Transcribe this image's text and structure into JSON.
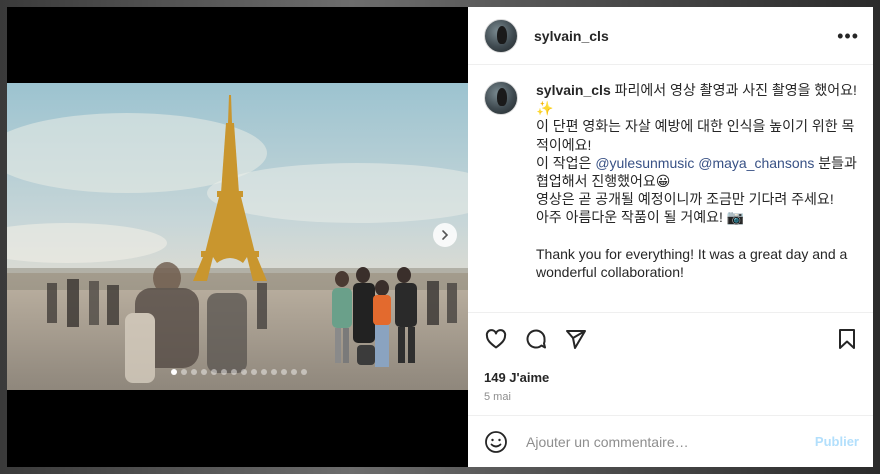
{
  "post": {
    "username": "sylvain_cls",
    "more_label": "•••",
    "caption": {
      "username": "sylvain_cls",
      "line1": " 파리에서 영상 촬영과 사진 촬영을 했어요! ✨",
      "line2": "이 단편 영화는 자살 예방에 대한 인식을 높이기 위한 목적이에요!",
      "line3_pre": "이 작업은 ",
      "mention1": "@yulesunmusic",
      "line3_mid": " ",
      "mention2": "@maya_chansons",
      "line3_post": " 분들과 협업해서 진행했어요😀",
      "line4": "영상은 곧 공개될 예정이니까 조금만 기다려 주세요!",
      "line5": "아주 아름다운 작품이 될 거예요! 📷",
      "line6": "Thank you for everything! It was a great day and a wonderful collaboration!"
    },
    "likes": "149 J'aime",
    "date": "5 mai",
    "comment_placeholder": "Ajouter un commentaire…",
    "publish_label": "Publier",
    "carousel": {
      "total": 14,
      "active_index": 0
    }
  },
  "icons": {
    "like": "heart-icon",
    "comment": "comment-icon",
    "share": "send-icon",
    "save": "bookmark-icon",
    "emoji": "emoji-icon",
    "next": "chevron-right-icon"
  },
  "colors": {
    "mention": "#385185",
    "publish_disabled": "#b2dffc",
    "text": "#262626",
    "muted": "#8e8e8e"
  }
}
